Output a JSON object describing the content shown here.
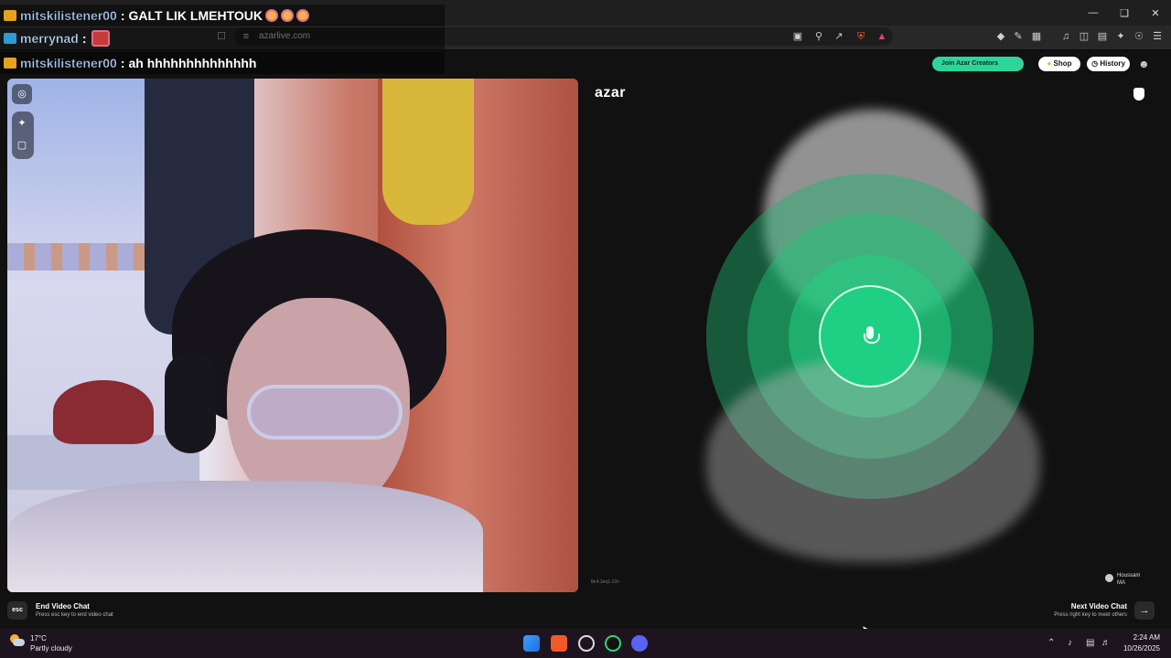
{
  "browser": {
    "url": "azarlive.com"
  },
  "chat": [
    {
      "user": "mitskilistener00",
      "sep": ":",
      "message": "GALT LIK LMEHTOUK"
    },
    {
      "user": "merrynad",
      "sep": ":",
      "message": ""
    },
    {
      "user": "mitskilistener00",
      "sep": ":",
      "message": "ah hhhhhhhhhhhhhh"
    }
  ],
  "header": {
    "creators_label": "Join Azar Creators",
    "shop_label": "Shop",
    "history_label": "History"
  },
  "remote": {
    "logo": "azar",
    "id_text": "fbr4.3eq1.22n",
    "user_name": "Houssam",
    "user_country": "MA"
  },
  "footer": {
    "esc_key": "esc",
    "end_title": "End Video Chat",
    "end_sub": "Press esc key to end video chat",
    "next_title": "Next Video Chat",
    "next_sub": "Press right key to meet others"
  },
  "taskbar": {
    "temperature": "17°C",
    "condition": "Partly cloudy",
    "time": "2:24 AM",
    "date": "10/26/2025"
  },
  "colors": {
    "accent_green": "#1fcf84",
    "creators_green": "#2ed59a"
  }
}
